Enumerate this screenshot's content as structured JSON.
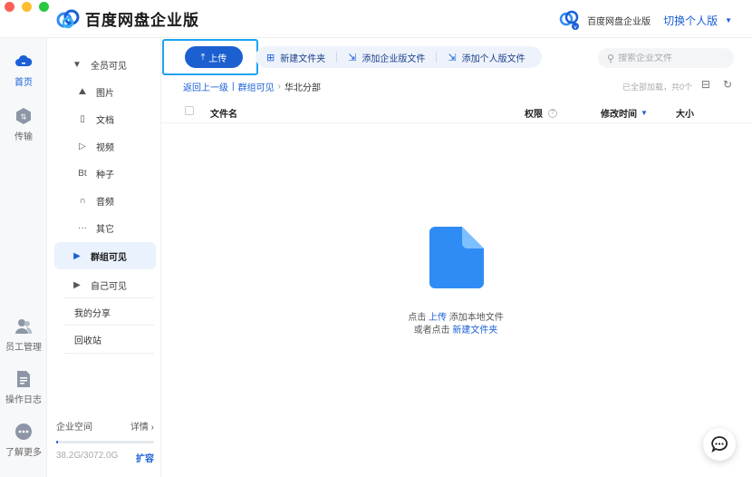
{
  "window": {
    "app_title": "百度网盘企业版"
  },
  "header": {
    "enterprise_name": "百度网盘企业版",
    "switch_label": "切换个人版"
  },
  "rail": {
    "items": [
      {
        "label": "首页",
        "icon": "cloud-home-icon",
        "active": true
      },
      {
        "label": "传输",
        "icon": "transfer-icon",
        "active": false
      },
      {
        "label": "员工管理",
        "icon": "staff-icon",
        "active": false
      },
      {
        "label": "操作日志",
        "icon": "log-icon",
        "active": false
      },
      {
        "label": "了解更多",
        "icon": "more-icon",
        "active": false
      }
    ]
  },
  "sidebar": {
    "all_visible": "全员可见",
    "categories": [
      {
        "label": "图片",
        "icon": "image-icon"
      },
      {
        "label": "文档",
        "icon": "document-icon"
      },
      {
        "label": "视频",
        "icon": "video-icon"
      },
      {
        "label": "种子",
        "icon": "torrent-icon"
      },
      {
        "label": "音频",
        "icon": "audio-icon"
      },
      {
        "label": "其它",
        "icon": "other-icon"
      }
    ],
    "group_visible": "群组可见",
    "self_visible": "自己可见",
    "my_share": "我的分享",
    "recycle_bin": "回收站",
    "storage": {
      "label": "企业空间",
      "details": "详情",
      "used_text": "38.2G/3072.0G",
      "used_fraction": 0.0124,
      "expand": "扩容"
    }
  },
  "toolbar": {
    "upload": "上传",
    "new_folder": "新建文件夹",
    "add_enterprise_file": "添加企业版文件",
    "add_personal_file": "添加个人版文件",
    "search_placeholder": "搜索企业文件"
  },
  "breadcrumb": {
    "back": "返回上一级",
    "parent": "群组可见",
    "current": "华北分部",
    "loaded_info": "已全部加载，共0个"
  },
  "table": {
    "col_name": "文件名",
    "col_permission": "权限",
    "col_modified": "修改时间",
    "col_size": "大小"
  },
  "empty": {
    "line1_prefix": "点击",
    "line1_link": "上传",
    "line1_suffix": "添加本地文件",
    "line2_prefix": "或者点击",
    "line2_link": "新建文件夹"
  },
  "colors": {
    "accent": "#1a5fd6",
    "upload_button": "#1c5fd0",
    "highlight_border": "#1aa3f0"
  }
}
